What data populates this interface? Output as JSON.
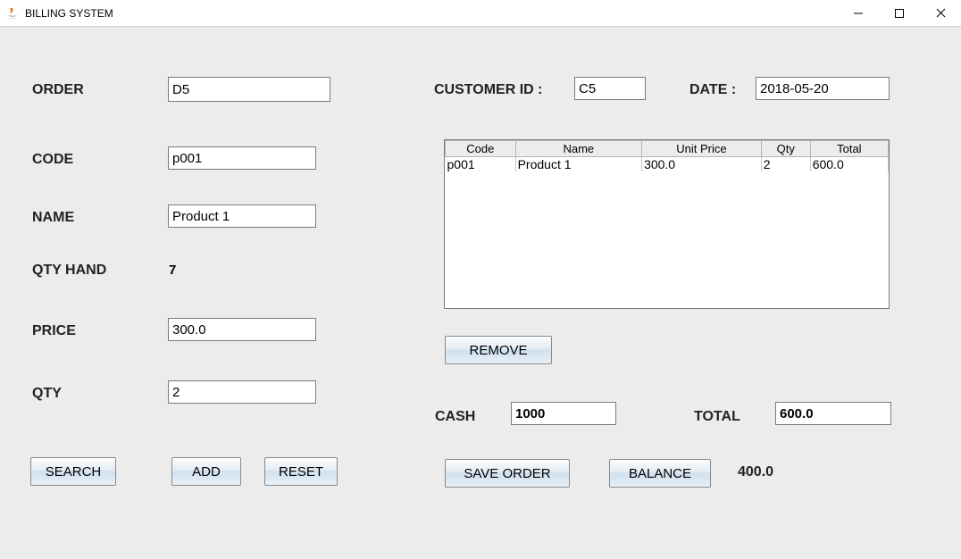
{
  "window": {
    "title": "BILLING SYSTEM"
  },
  "left": {
    "order_label": "ORDER",
    "order_value": "D5",
    "code_label": "CODE",
    "code_value": "p001",
    "name_label": "NAME",
    "name_value": "Product 1",
    "qtyhand_label": "QTY HAND",
    "qtyhand_value": "7",
    "price_label": "PRICE",
    "price_value": "300.0",
    "qty_label": "QTY",
    "qty_value": "2",
    "search_btn": "SEARCH",
    "add_btn": "ADD",
    "reset_btn": "RESET"
  },
  "top_right": {
    "customer_label": "CUSTOMER ID :",
    "customer_value": "C5",
    "date_label": "DATE :",
    "date_value": "2018-05-20"
  },
  "table": {
    "headers": [
      "Code",
      "Name",
      "Unit Price",
      "Qty",
      "Total"
    ],
    "rows": [
      {
        "code": "p001",
        "name": "Product 1",
        "unit_price": "300.0",
        "qty": "2",
        "total": "600.0"
      }
    ]
  },
  "bottom_right": {
    "remove_btn": "REMOVE",
    "cash_label": "CASH",
    "cash_value": "1000",
    "total_label": "TOTAL",
    "total_value": "600.0",
    "save_order_btn": "SAVE ORDER",
    "balance_btn": "BALANCE",
    "balance_value": "400.0"
  }
}
